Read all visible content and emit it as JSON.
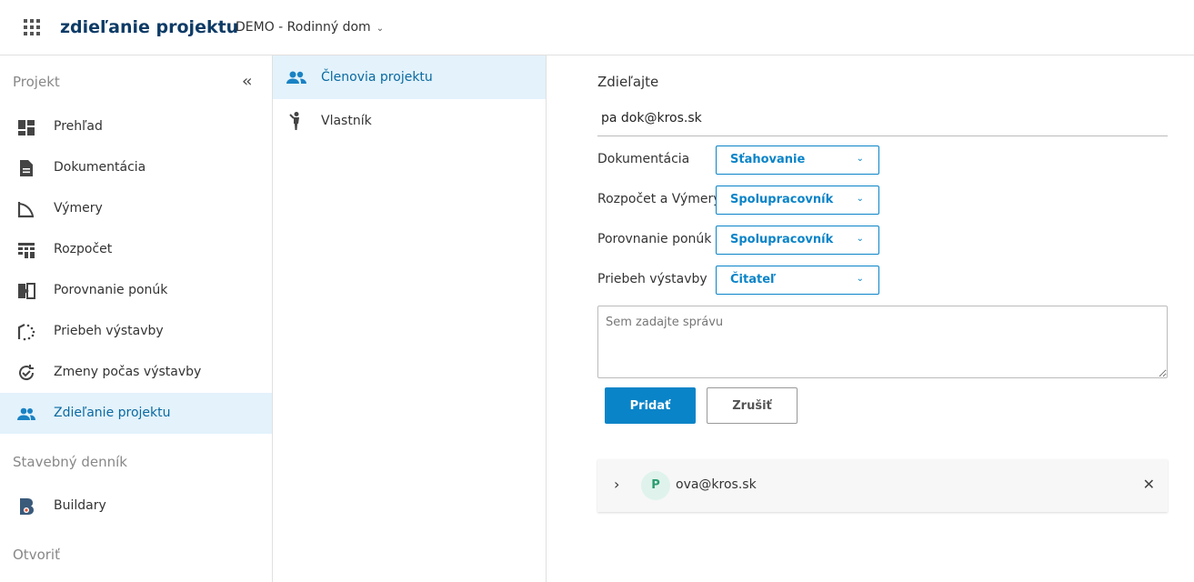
{
  "header": {
    "app_title": "zdieľanie projektu",
    "project_name": "DEMO - Rodinný dom"
  },
  "sidebar": {
    "section_project": "Projekt",
    "items": [
      {
        "label": "Prehľad",
        "icon": "dashboard-icon"
      },
      {
        "label": "Dokumentácia",
        "icon": "document-icon"
      },
      {
        "label": "Výmery",
        "icon": "measure-icon"
      },
      {
        "label": "Rozpočet",
        "icon": "budget-icon"
      },
      {
        "label": "Porovnanie ponúk",
        "icon": "compare-icon"
      },
      {
        "label": "Priebeh výstavby",
        "icon": "progress-icon"
      },
      {
        "label": "Zmeny počas výstavby",
        "icon": "changes-icon"
      },
      {
        "label": "Zdieľanie projektu",
        "icon": "people-icon",
        "active": true
      }
    ],
    "section_diary": "Stavebný denník",
    "diary_items": [
      {
        "label": "Buildary",
        "icon": "buildary-icon"
      }
    ],
    "section_open": "Otvoriť"
  },
  "subnav": {
    "items": [
      {
        "label": "Členovia projektu",
        "icon": "people-icon",
        "active": true
      },
      {
        "label": "Vlastník",
        "icon": "person-icon"
      }
    ]
  },
  "share": {
    "heading": "Zdieľajte",
    "email_value": "pa dok@kros.sk",
    "permissions": [
      {
        "label": "Dokumentácia",
        "value": "Sťahovanie"
      },
      {
        "label": "Rozpočet a Výmery",
        "value": "Spolupracovník"
      },
      {
        "label": "Porovnanie ponúk",
        "value": "Spolupracovník"
      },
      {
        "label": "Priebeh výstavby",
        "value": "Čitateľ"
      }
    ],
    "message_placeholder": "Sem zadajte správu",
    "add_label": "Pridať",
    "cancel_label": "Zrušiť"
  },
  "members": [
    {
      "initial": "P",
      "email": "ova@kros.sk"
    }
  ],
  "colors": {
    "accent": "#0a84c8",
    "brand_dark": "#0d3b66",
    "active_bg": "#e3f2fb"
  }
}
